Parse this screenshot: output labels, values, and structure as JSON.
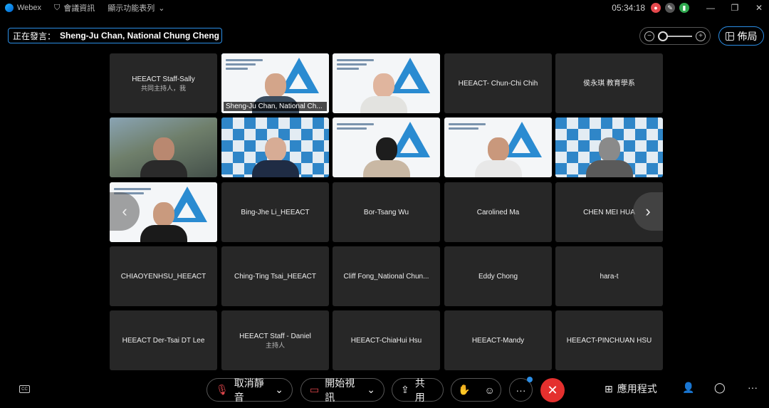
{
  "titlebar": {
    "app_name": "Webex",
    "meeting_info": "會議資訊",
    "menu_toggle": "顯示功能表列",
    "clock": "05:34:18"
  },
  "speaker": {
    "prefix": "正在發言：",
    "name": "Sheng-Ju Chan, National Chung Cheng ..."
  },
  "layout_button": "佈局",
  "tiles": [
    {
      "name": "HEEACT Staff-Sally",
      "sub": "共同主持人，我"
    },
    {
      "name": "Sheng-Ju Chan, National Ch...",
      "sub": ""
    },
    {
      "name": "",
      "sub": ""
    },
    {
      "name": "HEEACT- Chun-Chi Chih",
      "sub": ""
    },
    {
      "name": "侯永琪 教育學系",
      "sub": ""
    },
    {
      "name": "Bing-Jhe Li_HEEACT",
      "sub": ""
    },
    {
      "name": "Bor-Tsang Wu",
      "sub": ""
    },
    {
      "name": "Carolined Ma",
      "sub": ""
    },
    {
      "name": "CHEN MEI HUA",
      "sub": ""
    },
    {
      "name": "CHIAOYENHSU_HEEACT",
      "sub": ""
    },
    {
      "name": "Ching-Ting Tsai_HEEACT",
      "sub": ""
    },
    {
      "name": "Cliff Fong_National Chun...",
      "sub": ""
    },
    {
      "name": "Eddy Chong",
      "sub": ""
    },
    {
      "name": "hara-t",
      "sub": ""
    },
    {
      "name": "HEEACT Der-Tsai DT Lee",
      "sub": ""
    },
    {
      "name": "HEEACT Staff - Daniel",
      "sub": "主持人"
    },
    {
      "name": "HEEACT-ChiaHui Hsu",
      "sub": ""
    },
    {
      "name": "HEEACT-Mandy",
      "sub": ""
    },
    {
      "name": "HEEACT-PINCHUAN HSU",
      "sub": ""
    }
  ],
  "nav": {
    "prev": "‹",
    "next": "›"
  },
  "controls": {
    "mute": "取消靜音",
    "video": "開始視訊",
    "share": "共用",
    "more": "···",
    "end": "✕",
    "apps": "應用程式",
    "overflow": "···"
  },
  "colors": {
    "accent": "#2b8ee6",
    "end_call": "#e4302e",
    "tile_bg": "#272727"
  }
}
